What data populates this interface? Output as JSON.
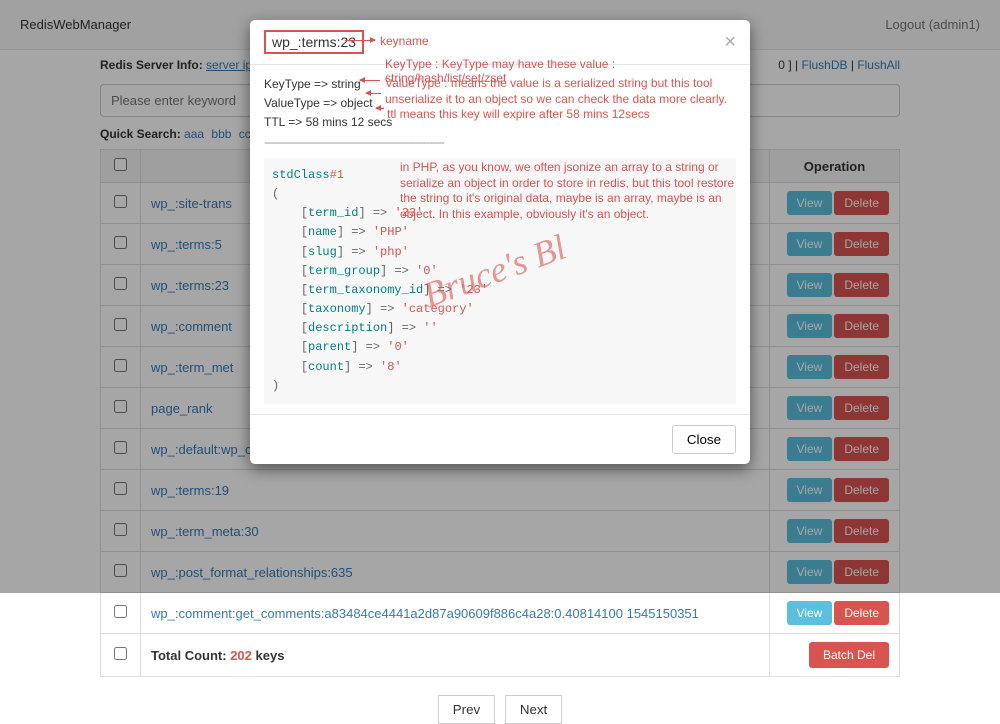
{
  "navbar": {
    "brand": "RedisWebManager",
    "logout": "Logout (admin1)"
  },
  "server_info": {
    "label": "Redis Server Info:",
    "server_ip_label": "server ip",
    "flushdb": "FlushDB",
    "flushall": "FlushAll",
    "sep": "|",
    "zero": "0",
    "bracket_close": "]"
  },
  "search": {
    "placeholder": "Please enter keyword"
  },
  "quick_search": {
    "label": "Quick Search:",
    "items": [
      "aaa",
      "bbb",
      "cc"
    ]
  },
  "table": {
    "headers": {
      "operation": "Operation"
    },
    "rows": [
      {
        "key": "wp_:site-trans"
      },
      {
        "key": "wp_:terms:5"
      },
      {
        "key": "wp_:terms:23"
      },
      {
        "key": "wp_:comment"
      },
      {
        "key": "wp_:term_met"
      },
      {
        "key": "page_rank"
      },
      {
        "key": "wp_:default:wp_cache_oc_key"
      },
      {
        "key": "wp_:terms:19"
      },
      {
        "key": "wp_:term_meta:30"
      },
      {
        "key": "wp_:post_format_relationships:635"
      },
      {
        "key": "wp_:comment:get_comments:a83484ce4441a2d87a90609f886c4a28:0.40814100 1545150351"
      }
    ],
    "total_label": "Total Count:",
    "total_count": "202",
    "total_suffix": "keys",
    "view": "View",
    "delete": "Delete",
    "batch_del": "Batch Del"
  },
  "pager": {
    "prev": "Prev",
    "next": "Next"
  },
  "modal": {
    "title": "wp_:terms:23",
    "meta": {
      "keytype": "KeyType => string",
      "valuetype": "ValueType => object",
      "ttl": "TTL => 58 mins 12 secs"
    },
    "sep": "------------------------------------------------------------",
    "code": {
      "class": "stdClass",
      "hash": "#1",
      "open": "(",
      "close": ")",
      "props": [
        {
          "k": "term_id",
          "v": "'23'"
        },
        {
          "k": "name",
          "v": "'PHP'"
        },
        {
          "k": "slug",
          "v": "'php'"
        },
        {
          "k": "term_group",
          "v": "'0'"
        },
        {
          "k": "term_taxonomy_id",
          "v": "'23'"
        },
        {
          "k": "taxonomy",
          "v": "'category'"
        },
        {
          "k": "description",
          "v": "''"
        },
        {
          "k": "parent",
          "v": "'0'"
        },
        {
          "k": "count",
          "v": "'8'"
        }
      ]
    },
    "close": "Close"
  },
  "annotations": {
    "keyname": "keyname",
    "keytype": "KeyType : KeyType may have these value : string/hash/list/set/zset",
    "valuetype": "ValueType : means the value is a serialized string but this tool unserialize it to an object so we can check the data more clearly.",
    "ttl": "ttl means this key will expire after 58 mins 12secs",
    "php": "in PHP, as you know, we often jsonize an array to a string or serialize an object in order to store in redis, but this tool restore the string to it's original data, maybe is an array, maybe is an object. In this example, obviously it's an object."
  },
  "watermark": "Bruce's Bl"
}
